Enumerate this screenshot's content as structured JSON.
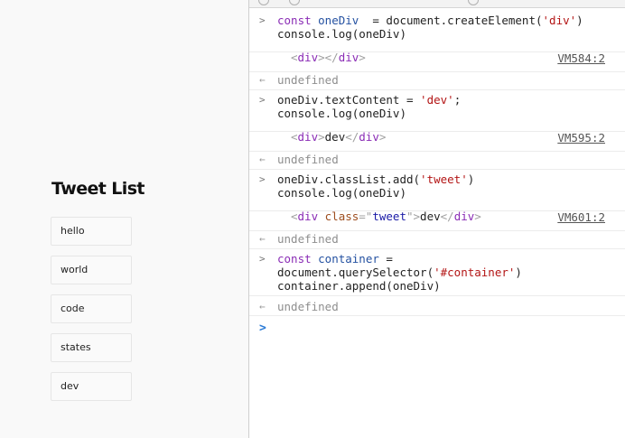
{
  "page": {
    "title": "Tweet List",
    "tweets": [
      "hello",
      "world",
      "code",
      "states",
      "dev"
    ]
  },
  "console": {
    "entries": [
      {
        "type": "input",
        "lines": [
          [
            [
              "kw",
              "const "
            ],
            [
              "vn",
              "oneDiv"
            ],
            [
              "",
              "  = document.createElement("
            ],
            [
              "str",
              "'div'"
            ],
            [
              "",
              ")"
            ]
          ],
          [
            [
              "",
              "console.log(oneDiv)"
            ]
          ]
        ]
      },
      {
        "type": "log",
        "lines": [
          [
            [
              "ang",
              "<"
            ],
            [
              "tag",
              "div"
            ],
            [
              "ang",
              ">"
            ],
            [
              "ang",
              "</"
            ],
            [
              "tag",
              "div"
            ],
            [
              "ang",
              ">"
            ]
          ]
        ],
        "link": "VM584:2"
      },
      {
        "type": "return",
        "lines": [
          [
            [
              "",
              "undefined"
            ]
          ]
        ]
      },
      {
        "type": "input",
        "lines": [
          [
            [
              "",
              "oneDiv.textContent = "
            ],
            [
              "str",
              "'dev'"
            ],
            [
              "",
              ";"
            ]
          ],
          [
            [
              "",
              "console.log(oneDiv)"
            ]
          ]
        ]
      },
      {
        "type": "log",
        "lines": [
          [
            [
              "ang",
              "<"
            ],
            [
              "tag",
              "div"
            ],
            [
              "ang",
              ">"
            ],
            [
              "",
              "dev"
            ],
            [
              "ang",
              "</"
            ],
            [
              "tag",
              "div"
            ],
            [
              "ang",
              ">"
            ]
          ]
        ],
        "link": "VM595:2"
      },
      {
        "type": "return",
        "lines": [
          [
            [
              "",
              "undefined"
            ]
          ]
        ]
      },
      {
        "type": "input",
        "lines": [
          [
            [
              "",
              "oneDiv.classList.add("
            ],
            [
              "str",
              "'tweet'"
            ],
            [
              "",
              ")"
            ]
          ],
          [
            [
              "",
              "console.log(oneDiv)"
            ]
          ]
        ]
      },
      {
        "type": "log",
        "lines": [
          [
            [
              "ang",
              "<"
            ],
            [
              "tag",
              "div "
            ],
            [
              "attr",
              "class"
            ],
            [
              "ang",
              "=\""
            ],
            [
              "aval",
              "tweet"
            ],
            [
              "ang",
              "\">"
            ],
            [
              "",
              "dev"
            ],
            [
              "ang",
              "</"
            ],
            [
              "tag",
              "div"
            ],
            [
              "ang",
              ">"
            ]
          ]
        ],
        "link": "VM601:2"
      },
      {
        "type": "return",
        "lines": [
          [
            [
              "",
              "undefined"
            ]
          ]
        ]
      },
      {
        "type": "input",
        "lines": [
          [
            [
              "kw",
              "const "
            ],
            [
              "vn",
              "container"
            ],
            [
              "",
              ""
            ],
            [
              "",
              " ="
            ]
          ],
          [
            [
              "",
              "document.querySelector("
            ],
            [
              "str",
              "'#container'"
            ],
            [
              "",
              ")"
            ]
          ],
          [
            [
              "",
              "container.append(oneDiv)"
            ]
          ]
        ]
      },
      {
        "type": "return",
        "lines": [
          [
            [
              "",
              "undefined"
            ]
          ]
        ]
      }
    ],
    "prompt_symbol": ">",
    "input_prefix": ">",
    "return_prefix": "←"
  },
  "colors": {
    "prompt": "#2a7ad5",
    "keyword": "#8a2cb5",
    "string": "#b31515"
  }
}
